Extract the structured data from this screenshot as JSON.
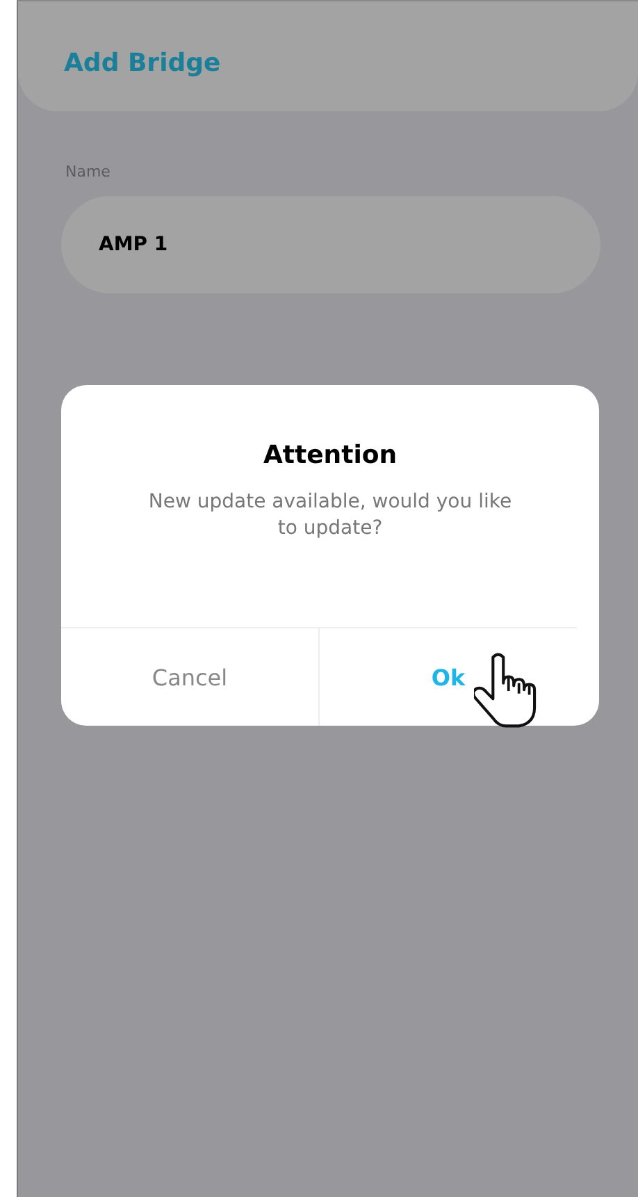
{
  "header": {
    "title": "Add Bridge"
  },
  "name_field": {
    "label": "Name",
    "value": "AMP 1"
  },
  "dialog": {
    "title": "Attention",
    "message": "New update available, would you like to update?",
    "buttons": [
      {
        "label": "Cancel",
        "kind": "cancel"
      },
      {
        "label": "Ok",
        "kind": "confirm"
      }
    ]
  }
}
